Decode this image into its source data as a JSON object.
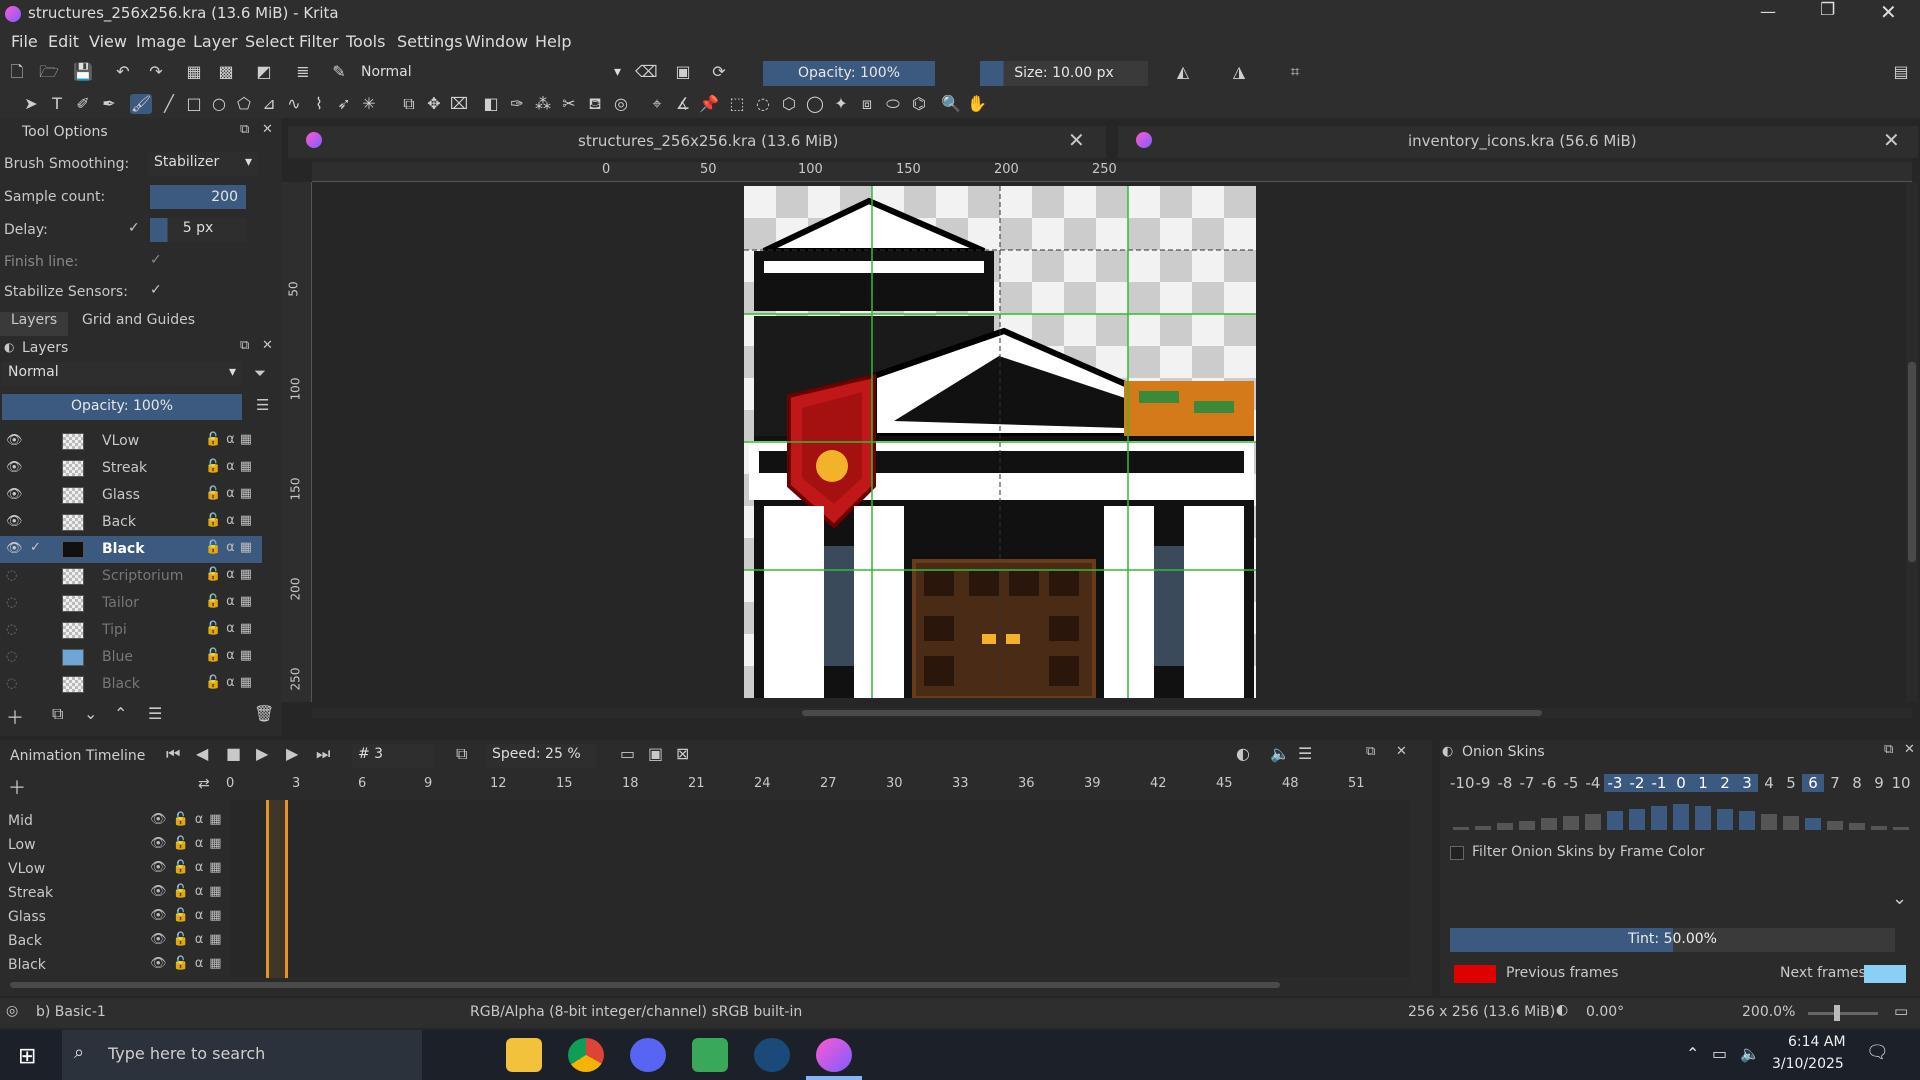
{
  "window": {
    "title": "structures_256x256.kra (13.6 MiB)  - Krita"
  },
  "menu": [
    "File",
    "Edit",
    "View",
    "Image",
    "Layer",
    "Select",
    "Filter",
    "Tools",
    "Settings",
    "Window",
    "Help"
  ],
  "toolbar": {
    "blend_mode": "Normal",
    "opacity": "Opacity: 100%",
    "size": "Size: 10.00 px"
  },
  "tool_options": {
    "title": "Tool Options",
    "brush_smoothing_label": "Brush Smoothing:",
    "brush_smoothing_value": "Stabilizer",
    "sample_count_label": "Sample count:",
    "sample_count_value": "200",
    "delay_label": "Delay:",
    "delay_value": "5 px",
    "finish_line_label": "Finish line:",
    "stabilize_sensors_label": "Stabilize Sensors:"
  },
  "panel_tabs": [
    "Layers",
    "Grid and Guides"
  ],
  "layers": {
    "title": "Layers",
    "blend_mode": "Normal",
    "opacity": "Opacity:  100%",
    "items": [
      {
        "name": "VLow",
        "active": true
      },
      {
        "name": "Streak",
        "active": true
      },
      {
        "name": "Glass",
        "active": true
      },
      {
        "name": "Back",
        "active": true
      },
      {
        "name": "Black",
        "active": true,
        "selected": true
      },
      {
        "name": "Scriptorium",
        "active": false
      },
      {
        "name": "Tailor",
        "active": false
      },
      {
        "name": "Tipi",
        "active": false
      },
      {
        "name": "Blue",
        "active": false
      },
      {
        "name": "Black",
        "active": false
      }
    ]
  },
  "documents": [
    {
      "title": "structures_256x256.kra (13.6 MiB)"
    },
    {
      "title": "inventory_icons.kra (56.6 MiB)"
    }
  ],
  "ruler_top": [
    "0",
    "50",
    "100",
    "150",
    "200",
    "250"
  ],
  "ruler_left": [
    "50",
    "100",
    "150",
    "200",
    "250"
  ],
  "timeline": {
    "title": "Animation Timeline",
    "frame": "# 3",
    "speed": "Speed: 25 %",
    "frame_numbers": [
      "0",
      "3",
      "6",
      "9",
      "12",
      "15",
      "18",
      "21",
      "24",
      "27",
      "30",
      "33",
      "36",
      "39",
      "42",
      "45",
      "48",
      "51"
    ],
    "layers": [
      "Mid",
      "Low",
      "VLow",
      "Streak",
      "Glass",
      "Back",
      "Black"
    ]
  },
  "onion": {
    "title": "Onion Skins",
    "numbers": [
      "-10",
      "-9",
      "-8",
      "-7",
      "-6",
      "-5",
      "-4",
      "-3",
      "-2",
      "-1",
      "0",
      "1",
      "2",
      "3",
      "4",
      "5",
      "6",
      "7",
      "8",
      "9",
      "10"
    ],
    "filter_label": "Filter Onion Skins by Frame Color",
    "tint": "Tint: 50.00%",
    "tint_value": 0.5,
    "previous_label": "Previous frames",
    "next_label": "Next frames",
    "previous_color": "#e00000",
    "next_color": "#8ad0f5"
  },
  "status": {
    "brush": "b) Basic-1",
    "color_space": "RGB/Alpha (8-bit integer/channel)  sRGB built-in",
    "image_size": "256 x 256 (13.6 MiB)",
    "rotation": "0.00°",
    "zoom": "200.0%"
  },
  "taskbar": {
    "search_placeholder": "Type here to search",
    "time": "6:14 AM",
    "date": "3/10/2025"
  }
}
